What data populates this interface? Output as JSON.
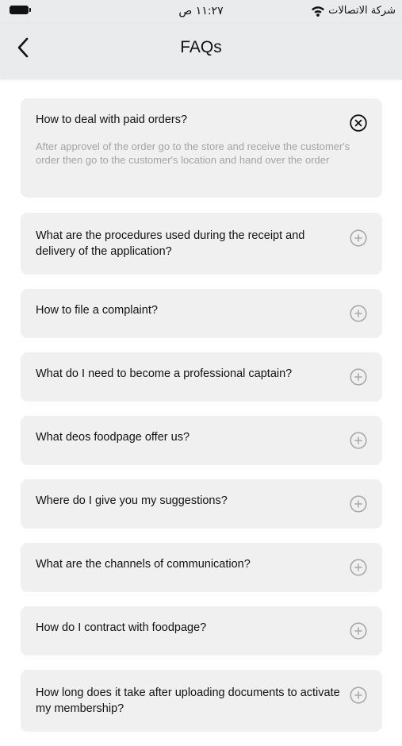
{
  "status_bar": {
    "time": "١١:٢٧ ص",
    "carrier": "شركة الاتصالات",
    "icons": [
      "battery-icon",
      "wifi-icon"
    ]
  },
  "header": {
    "title": "FAQs",
    "back_icon": "chevron-left-icon"
  },
  "faqs": [
    {
      "question": "How to deal with paid orders?",
      "answer": "After approvel of the order go to the store and receive the customer's order then go to the customer's location and hand over the order",
      "expanded": true,
      "icon": "close-circle-icon"
    },
    {
      "question": "What are the procedures used during the receipt and delivery of the application?",
      "expanded": false,
      "icon": "plus-circle-icon"
    },
    {
      "question": "How to file a complaint?",
      "expanded": false,
      "icon": "plus-circle-icon"
    },
    {
      "question": "What do I need to become a professional captain?",
      "expanded": false,
      "icon": "plus-circle-icon"
    },
    {
      "question": "What deos foodpage offer us?",
      "expanded": false,
      "icon": "plus-circle-icon"
    },
    {
      "question": "Where do I give you my suggestions?",
      "expanded": false,
      "icon": "plus-circle-icon"
    },
    {
      "question": "What are the channels of communication?",
      "expanded": false,
      "icon": "plus-circle-icon"
    },
    {
      "question": "How do I contract with foodpage?",
      "expanded": false,
      "icon": "plus-circle-icon"
    },
    {
      "question": "How long does it take after uploading documents to activate my membership?",
      "expanded": false,
      "icon": "plus-circle-icon"
    }
  ],
  "colors": {
    "header_background": "#e9ebec",
    "card_background": "#f0f0f0",
    "answer_text": "#a4a4a4",
    "toggle_icon": "#a8a8a8"
  }
}
